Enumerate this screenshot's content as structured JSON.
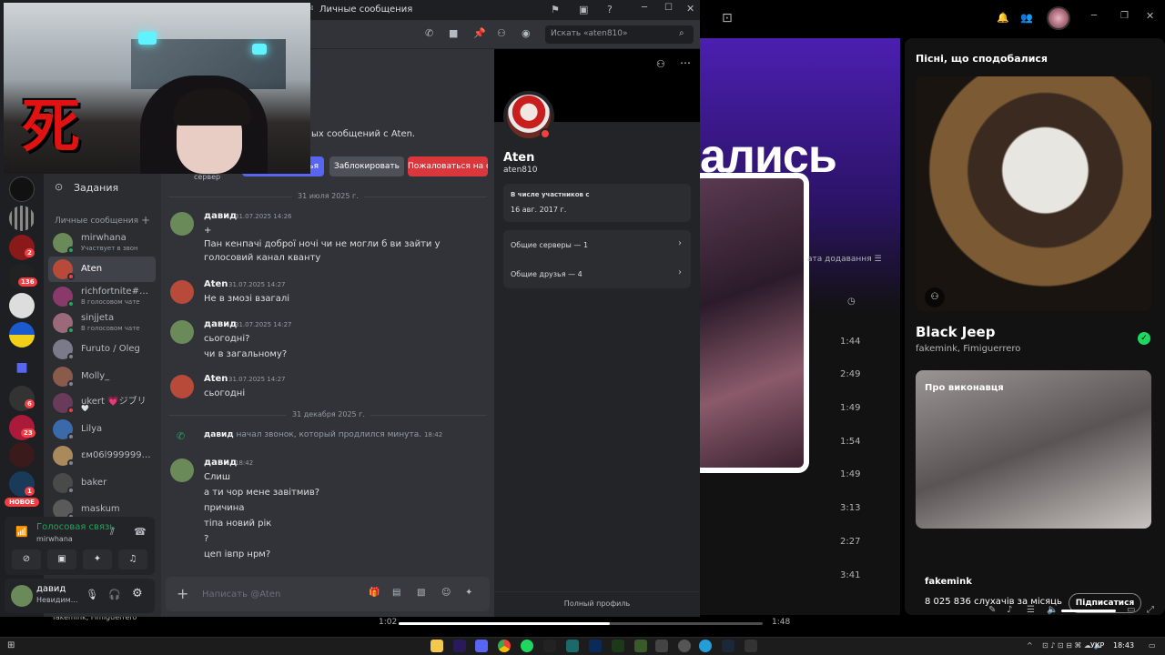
{
  "discord": {
    "window_title": "Личные сообщения",
    "tasks_label": "Задания",
    "dm_header": "Личные сообщения",
    "dms": [
      {
        "name": "mirwhana",
        "sub": "Участвует в звон",
        "color": "#6a8a5a",
        "status": "#23a55a"
      },
      {
        "name": "Aten",
        "sub": "",
        "color": "#b84a3a",
        "status": "#f23f43",
        "selected": true
      },
      {
        "name": "richfortnite#…",
        "sub": "В голосовом чате",
        "color": "#8a3a6a",
        "status": "#23a55a"
      },
      {
        "name": "sinjjeta",
        "sub": "В голосовом чате",
        "color": "#9a6a7a",
        "status": "#23a55a"
      },
      {
        "name": "Furuto / Oleg",
        "sub": "",
        "color": "#7a7a8a",
        "status": "#80848e"
      },
      {
        "name": "Molly_",
        "sub": "",
        "color": "#8a5a4a",
        "status": "#80848e"
      },
      {
        "name": "ukert 💗ジブリ",
        "sub": "🤍",
        "color": "#6a3a5a",
        "status": "#f23f43"
      },
      {
        "name": "Lilya",
        "sub": "",
        "color": "#3a6aaa",
        "status": "#80848e"
      },
      {
        "name": "ɛм06l999999…",
        "sub": "",
        "color": "#aa8a5a",
        "status": "#80848e"
      },
      {
        "name": "baker",
        "sub": "",
        "color": "#4a4a4a",
        "status": "#80848e"
      },
      {
        "name": "maskum",
        "sub": "",
        "color": "#5a5a5a",
        "status": "#80848e"
      }
    ],
    "guild_badges": [
      "2",
      "136",
      "6",
      "23",
      "1"
    ],
    "new_badge": "НОВОЕ",
    "voice": {
      "title": "Голосовая связь",
      "sub": "mirwhana"
    },
    "user": {
      "name": "давид",
      "status": "Невидим…"
    },
    "search_placeholder": "Искать «aten810»",
    "intro_text": "ых сообщений с Aten.",
    "intro_buttons": {
      "add": "ья",
      "block": "Заблокировать",
      "report": "Пожаловаться на с"
    },
    "server_label": "сервер",
    "dividers": [
      "31 июля 2025 г.",
      "31 декабря 2025 г."
    ],
    "messages": [
      {
        "name": "давид",
        "time": "31.07.2025 14:26",
        "lines": [
          "+",
          "Пан кенпачі доброї ночі чи не могли б ви зайти у голосовий канал кванту"
        ]
      },
      {
        "name": "Aten",
        "time": "31.07.2025 14:27",
        "lines": [
          "Не в змозі взагалі"
        ]
      },
      {
        "name": "давид",
        "time": "31.07.2025 14:27",
        "lines": [
          "сьогодні?",
          "чи в загальному?"
        ]
      },
      {
        "name": "Aten",
        "time": "31.07.2025 14:27",
        "lines": [
          "сьогодні"
        ]
      },
      {
        "name": "давид",
        "time": "18:42",
        "lines": [
          "Слиш",
          "а ти чор мене завітмив?",
          "причина",
          "тіпа новий рік",
          "?",
          "цеп івпр нрм?"
        ]
      }
    ],
    "call": {
      "name": "давид",
      "text": "начал звонок, который продлился минута.",
      "time": "18:42"
    },
    "composer_placeholder": "Написать @Aten",
    "profile": {
      "name": "Aten",
      "username": "aten810",
      "member_since_label": "В числе участников с",
      "member_since": "16 авг. 2017 г.",
      "mutual_servers": "Общие серверы — 1",
      "mutual_friends": "Общие друзья — 4",
      "full_profile": "Полный профиль"
    }
  },
  "spotify": {
    "big_title": "ались",
    "date_added": "ата додавання",
    "durations": [
      "1:44",
      "2:49",
      "1:49",
      "1:54",
      "1:49",
      "3:13",
      "2:27",
      "3:41"
    ],
    "panel_title": "Пісні, що сподобалися",
    "track": "Black Jeep",
    "artists": "fakemink, Fimiguerrero",
    "about_title": "Про виконавця",
    "artist_name": "fakemink",
    "listeners": "8 025 836 слухачів за місяць",
    "follow_label": "Підписатися",
    "time_elapsed": "1:02",
    "time_total": "1:48",
    "progress_fraction": 0.58,
    "now_playing_artists": "fakemink, Fimiguerrero"
  },
  "taskbar": {
    "lang": "УКР",
    "time": "18:43"
  },
  "overlay": {
    "kanji": "死"
  }
}
